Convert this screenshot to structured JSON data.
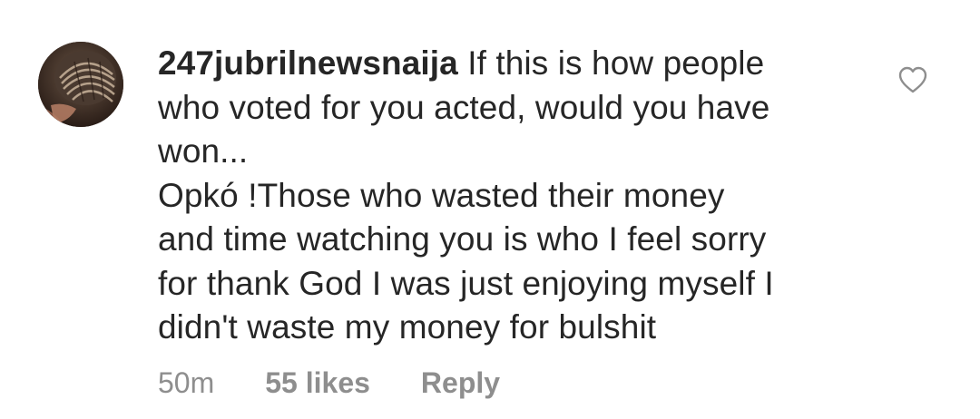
{
  "comment": {
    "username": "247jubrilnewsnaija",
    "lines": [
      "If this is how people",
      "who voted for you acted, would you have",
      "won...",
      "Opkó !Those who wasted their money",
      "and time watching you is who I feel sorry",
      "for thank God I was just enjoying myself I",
      "didn't waste my money for bulshit"
    ],
    "time": "50m",
    "likes": "55 likes",
    "reply_label": "Reply"
  },
  "icons": {
    "like": "heart-outline-icon",
    "avatar": "user-avatar"
  },
  "colors": {
    "text": "#262626",
    "meta": "#8e8e8e",
    "heart_stroke": "#8e8e8e"
  }
}
